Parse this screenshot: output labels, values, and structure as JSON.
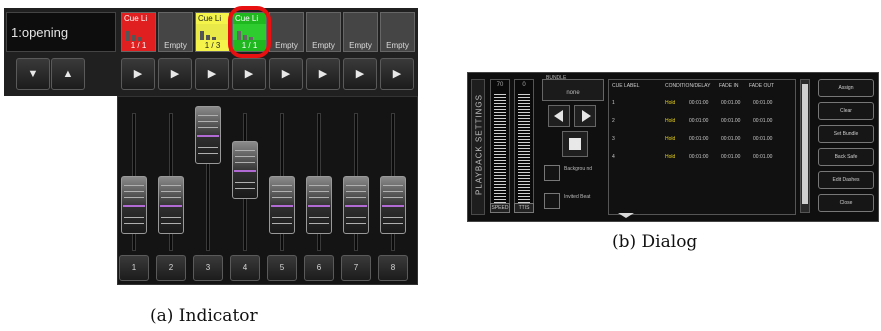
{
  "panel_a": {
    "cue_name": "1:opening",
    "slots": [
      {
        "head": "Cue Li",
        "foot": "1 / 1",
        "state": "red"
      },
      {
        "head": "",
        "foot": "Empty",
        "state": "empty"
      },
      {
        "head": "Cue Li",
        "foot": "1 / 3",
        "state": "yellow"
      },
      {
        "head": "Cue Li",
        "foot": "1 / 1",
        "state": "green"
      },
      {
        "head": "",
        "foot": "Empty",
        "state": "empty"
      },
      {
        "head": "",
        "foot": "Empty",
        "state": "empty"
      },
      {
        "head": "",
        "foot": "Empty",
        "state": "empty"
      },
      {
        "head": "",
        "foot": "Empty",
        "state": "empty"
      }
    ],
    "nav": {
      "down": "▼",
      "up": "▲"
    },
    "go_label": "▶",
    "faders": [
      {
        "label": "1",
        "level": 0.25
      },
      {
        "label": "2",
        "level": 0.25
      },
      {
        "label": "3",
        "level": 0.95
      },
      {
        "label": "4",
        "level": 0.6
      },
      {
        "label": "5",
        "level": 0.25
      },
      {
        "label": "6",
        "level": 0.25
      },
      {
        "label": "7",
        "level": 0.25
      },
      {
        "label": "8",
        "level": 0.25
      }
    ],
    "caption": "(a) Indicator",
    "colors": {
      "red": "#e02020",
      "yellow": "#f4f44a",
      "green": "#1fb81f",
      "highlight": "#e81010",
      "fader_center": "#b169d3"
    }
  },
  "panel_b": {
    "title": "PLAYBACK SETTINGS",
    "meter_left": {
      "value": "70",
      "tag": "SPEED"
    },
    "meter_right": {
      "value": "0",
      "tag": "TTIS"
    },
    "bundle": {
      "label": "BUNDLE",
      "value": "none"
    },
    "checkbox_1": "Backgrou nd",
    "checkbox_2": "Invited Beat",
    "table": {
      "headers": [
        "CUE LABEL",
        "CONDITION/DELAY",
        "FADE IN",
        "FADE OUT"
      ],
      "rows": [
        {
          "num": "1",
          "cond": "Hold",
          "delay": "00:01:00",
          "fade_in": "00:01.00",
          "fade_out": "00:01.00"
        },
        {
          "num": "2",
          "cond": "Hold",
          "delay": "00:01:00",
          "fade_in": "00:01.00",
          "fade_out": "00:01.00"
        },
        {
          "num": "3",
          "cond": "Hold",
          "delay": "00:01:00",
          "fade_in": "00:01.00",
          "fade_out": "00:01.00"
        },
        {
          "num": "4",
          "cond": "Hold",
          "delay": "00:01:00",
          "fade_in": "00:01.00",
          "fade_out": "00:01.00"
        }
      ]
    },
    "side_buttons": [
      "Assign",
      "Clear",
      "Set Bundle",
      "Back Safe",
      "Edit Dashes",
      "Close"
    ],
    "caption": "(b) Dialog"
  }
}
